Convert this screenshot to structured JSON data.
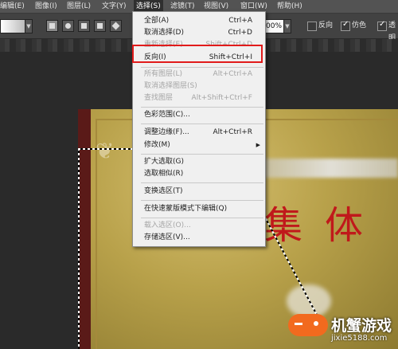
{
  "menubar": {
    "items": [
      "编辑(E)",
      "图像(I)",
      "图层(L)",
      "文字(Y)",
      "选择(S)",
      "滤镜(T)",
      "视图(V)",
      "窗口(W)",
      "帮助(H)"
    ]
  },
  "options": {
    "opacity_value": "00%",
    "reverse_label": "反向",
    "dither_label": "仿色",
    "transparency_label": "透明"
  },
  "select_menu": {
    "items": [
      {
        "label": "全部(A)",
        "shortcut": "Ctrl+A",
        "enabled": true
      },
      {
        "label": "取消选择(D)",
        "shortcut": "Ctrl+D",
        "enabled": true
      },
      {
        "label": "重新选择(E)",
        "shortcut": "Shift+Ctrl+D",
        "enabled": false
      },
      {
        "label": "反向(I)",
        "shortcut": "Shift+Ctrl+I",
        "enabled": true
      },
      {
        "label": "所有图层(L)",
        "shortcut": "Alt+Ctrl+A",
        "enabled": false
      },
      {
        "label": "取消选择图层(S)",
        "shortcut": "",
        "enabled": false
      },
      {
        "label": "查找图层",
        "shortcut": "Alt+Shift+Ctrl+F",
        "enabled": false
      },
      {
        "label": "色彩范围(C)...",
        "shortcut": "",
        "enabled": true
      },
      {
        "label": "调整边缘(F)...",
        "shortcut": "Alt+Ctrl+R",
        "enabled": true
      },
      {
        "label": "修改(M)",
        "shortcut": "",
        "enabled": true,
        "submenu": true
      },
      {
        "label": "扩大选取(G)",
        "shortcut": "",
        "enabled": true
      },
      {
        "label": "选取相似(R)",
        "shortcut": "",
        "enabled": true
      },
      {
        "label": "变换选区(T)",
        "shortcut": "",
        "enabled": true
      },
      {
        "label": "在快速蒙版模式下编辑(Q)",
        "shortcut": "",
        "enabled": true
      },
      {
        "label": "载入选区(O)...",
        "shortcut": "",
        "enabled": false
      },
      {
        "label": "存储选区(V)...",
        "shortcut": "",
        "enabled": true
      }
    ],
    "submenu_arrow": "▶"
  },
  "canvas": {
    "plaque_text": "先进集体"
  },
  "watermark": {
    "brand": "机蟹游戏",
    "url": "jixie5188.com"
  },
  "colors": {
    "highlight_box": "#e11b1b",
    "plaque_text": "#c0191b"
  }
}
